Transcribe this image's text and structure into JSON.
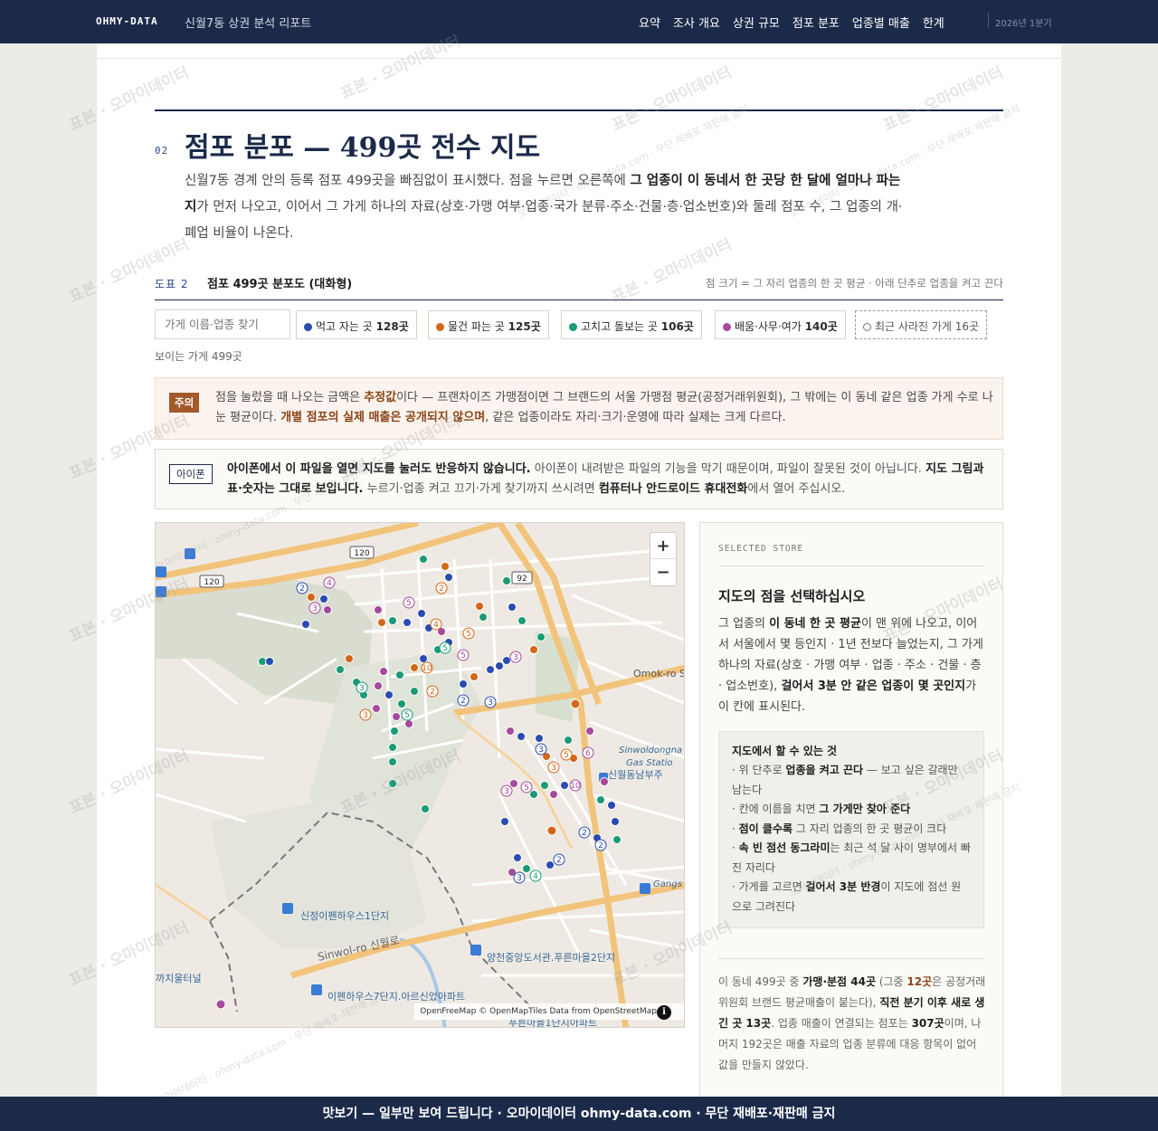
{
  "header": {
    "brand": "OHMY-DATA",
    "subtitle": "신월7동 상권 분석 리포트",
    "nav": [
      "요약",
      "조사 개요",
      "상권 규모",
      "점포 분포",
      "업종별 매출",
      "한계"
    ],
    "period": "2026년 1분기"
  },
  "section": {
    "number": "02",
    "title": "점포 분포 — 499곳 전수 지도",
    "intro_1": "신월7동 경계 안의 등록 점포 499곳을 빠짐없이 표시했다. 점을 누르면 오른쪽에 ",
    "intro_b1": "그 업종이 이 동네서 한 곳당 한 달에 얼마나 파는지",
    "intro_2": "가 먼저 나오고, 이어서 그 가게 하나의 자료(상호·가맹 여부·업종·국가 분류·주소·건물·층·업소번호)와 둘레 점포 수, 그 업종의 개·폐업 비율이 나온다."
  },
  "figure": {
    "label": "도표 2",
    "title": "점포 499곳 분포도 (대화형)",
    "note": "점 크기 = 그 자리 업종의 한 곳 평균 · 아래 단추로 업종을 켜고 끈다"
  },
  "filters": {
    "search_placeholder": "가게 이름·업종 찾기",
    "chips": [
      {
        "label": "먹고 자는 곳",
        "count": "128곳",
        "color": "#2a4bb0"
      },
      {
        "label": "물건 파는 곳",
        "count": "125곳",
        "color": "#d4661a"
      },
      {
        "label": "고치고 돌보는 곳",
        "count": "106곳",
        "color": "#1a9b76"
      },
      {
        "label": "배움·사무·여가",
        "count": "140곳",
        "color": "#a64a9c"
      }
    ],
    "closed_chip": "최근 사라진 가게 16곳",
    "visible": "보이는 가게 499곳"
  },
  "warning": {
    "tag": "주의",
    "t1": "점을 눌렀을 때 나오는 금액은 ",
    "b1": "추정값",
    "t2": "이다 — 프랜차이즈 가맹점이면 그 브랜드의 서울 가맹점 평균(공정거래위원회), 그 밖에는 이 동네 같은 업종 가게 수로 나눈 평균이다. ",
    "b2": "개별 점포의 실제 매출은 공개되지 않으며",
    "t3": ", 같은 업종이라도 자리·크기·운영에 따라 실제는 크게 다르다."
  },
  "ios": {
    "tag": "아이폰",
    "b1": "아이폰에서 이 파일을 열면 지도를 눌러도 반응하지 않습니다.",
    "t1": " 아이폰이 내려받은 파일의 기능을 막기 때문이며, 파일이 잘못된 것이 아닙니다. ",
    "b2": "지도 그림과 표·숫자는 그대로 보입니다.",
    "t2": " 누르기·업종 켜고 끄기·가게 찾기까지 쓰시려면 ",
    "b3": "컴퓨터나 안드로이드 휴대전화",
    "t3": "에서 열어 주십시오."
  },
  "map": {
    "zoom_in": "+",
    "zoom_out": "−",
    "attribution": "OpenFreeMap © OpenMapTiles Data from OpenStreetMap",
    "info": "i",
    "labels": {
      "road_120a": "120",
      "road_120b": "120",
      "road_92": "92",
      "omok": "Omok-ro S",
      "gas1": "Sinwoldongna",
      "gas2": "Gas Statio",
      "stop1": "신월동남부주",
      "gangs": "Gangs",
      "apt1": "신정이펜하우스1단지",
      "sinwol_ro": "Sinwol-ro 신월로",
      "library": "양천중앙도서관.푸른마을2단지",
      "kkachi": "까치울터널",
      "apt2": "이펜하우스7단지.아르신었아파트",
      "apt3": "푸른마을1단지아파트"
    }
  },
  "panel": {
    "eyebrow": "SELECTED STORE",
    "title": "지도의 점을 선택하십시오",
    "d1": "그 업종의 ",
    "db1": "이 동네 한 곳 평균",
    "d2": "이 맨 위에 나오고, 이어서 서울에서 몇 등인지 · 1년 전보다 늘었는지, 그 가게 하나의 자료(상호 · 가맹 여부 · 업종 · 주소 · 건물 · 층 · 업소번호), ",
    "db2": "걸어서 3분 안 같은 업종이 몇 곳인지",
    "d3": "가 이 칸에 표시된다.",
    "howto_title": "지도에서 할 수 있는 것",
    "h1a": "· 위 단추로 ",
    "h1b": "업종을 켜고 끈다",
    "h1c": " — 보고 싶은 갈래만 남는다",
    "h2a": "· 칸에 이름을 치면 ",
    "h2b": "그 가게만 찾아 준다",
    "h3a": "· ",
    "h3b": "점이 클수록",
    "h3c": " 그 자리 업종의 한 곳 평균이 크다",
    "h4a": "· ",
    "h4b": "속 빈 점선 동그라미",
    "h4c": "는 최근 석 달 사이 명부에서 빠진 자리다",
    "h5a": "· 가게를 고르면 ",
    "h5b": "걸어서 3분 반경",
    "h5c": "이 지도에 점선 원으로 그려진다",
    "f1": "이 동네 499곳 중 ",
    "fb1": "가맹·분점 44곳",
    "f2": " (그중 ",
    "fh1": "12곳",
    "f3": "은 공정거래위원회 브랜드 평균매출이 붙는다), ",
    "fb2": "직전 분기 이후 새로 생긴 곳 13곳",
    "f4": ". 업종 매출이 연결되는 점포는 ",
    "fb3": "307곳",
    "f5": "이며, 나머지 192곳은 매출 자료의 업종 분류에 대응 항목이 없어 값을 만들지 않았다."
  },
  "footer": "맛보기 — 일부만 보여 드립니다 · 오마이데이터 ohmy-data.com · 무단 재배포·재판매 금지",
  "watermark": {
    "main": "표본 · 오마이데이터",
    "sub": "오마이데이터 · ohmy-data.com · 무단 재배포·재판매 금지"
  }
}
